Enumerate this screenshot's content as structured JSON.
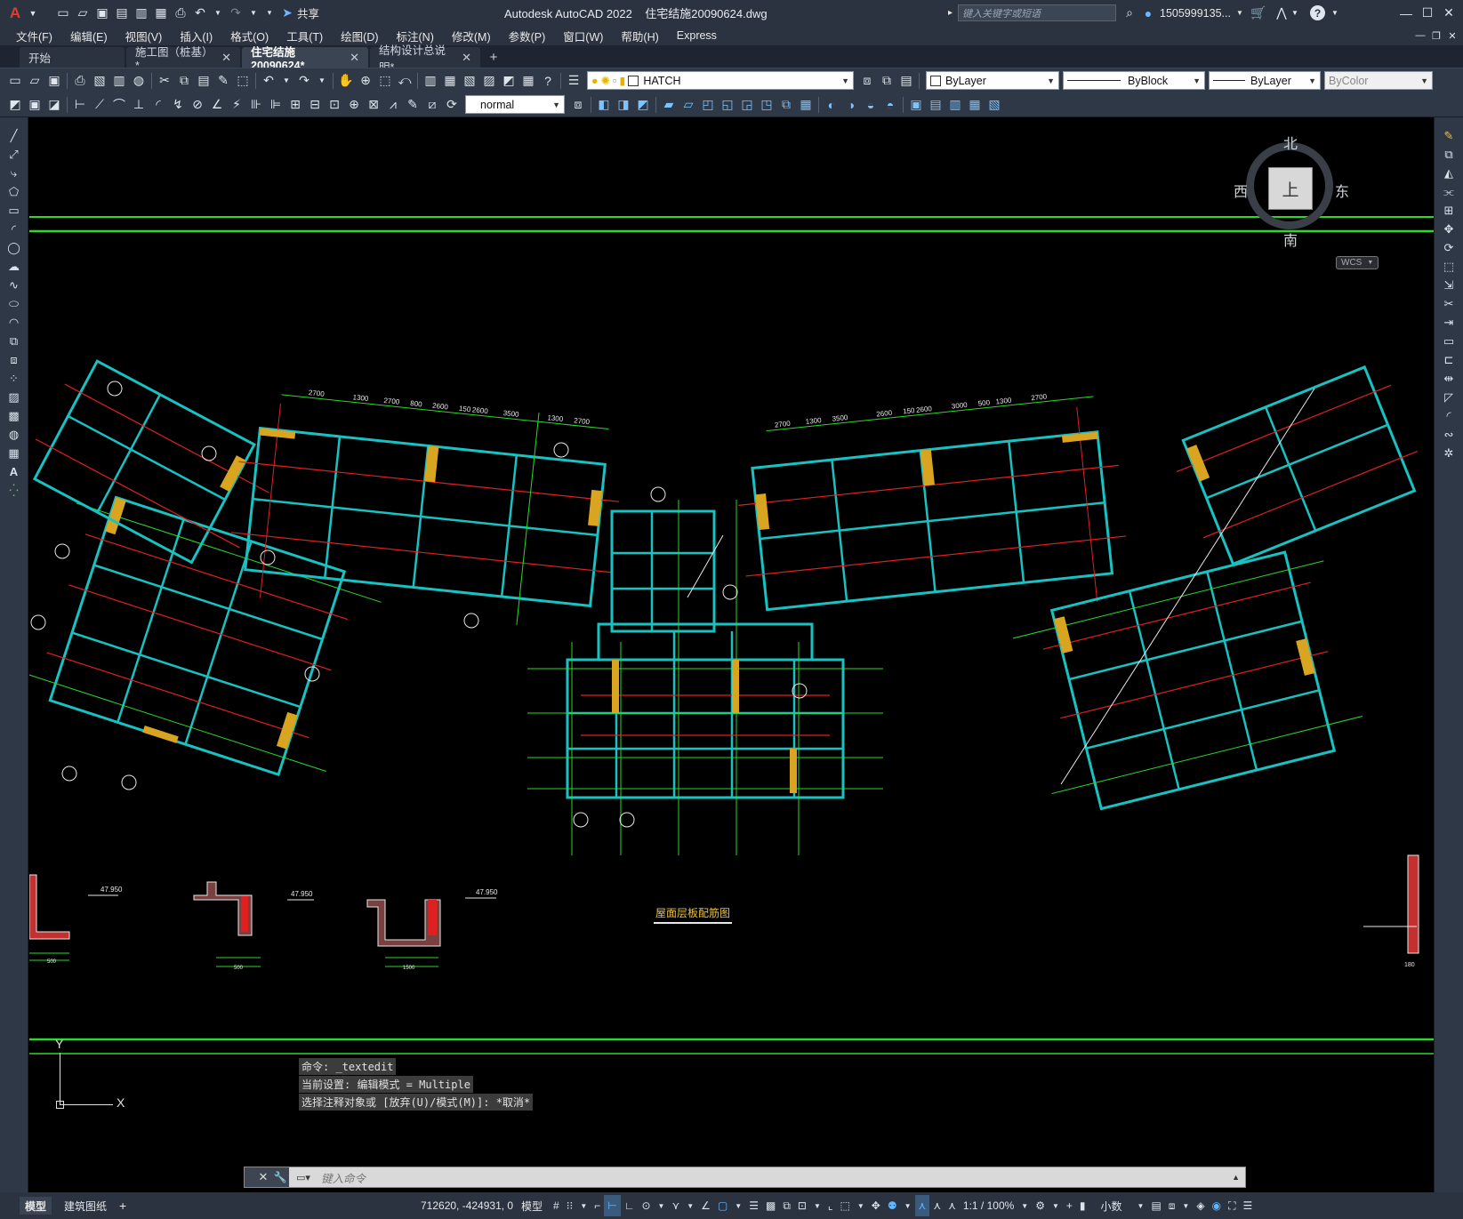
{
  "app": {
    "logo": "A",
    "share_label": "共享",
    "title": "Autodesk AutoCAD 2022    住宅结施20090624.dwg",
    "search_placeholder": "键入关键字或短语",
    "user": "1505999135...",
    "help": "?"
  },
  "menu": [
    "文件(F)",
    "编辑(E)",
    "视图(V)",
    "插入(I)",
    "格式(O)",
    "工具(T)",
    "绘图(D)",
    "标注(N)",
    "修改(M)",
    "参数(P)",
    "窗口(W)",
    "帮助(H)",
    "Express"
  ],
  "tabs": [
    {
      "label": "开始",
      "close": "",
      "active": false
    },
    {
      "label": "施工图（桩基）*",
      "close": "✕",
      "active": false
    },
    {
      "label": "住宅结施20090624*",
      "close": "✕",
      "active": true
    },
    {
      "label": "结构设计总说明*",
      "close": "✕",
      "active": false
    }
  ],
  "tab_add": "+",
  "toolbar": {
    "layer": "HATCH",
    "color": "ByLayer",
    "linetype": "ByBlock",
    "lineweight": "ByLayer",
    "plotstyle": "ByColor",
    "dimstyle": "normal"
  },
  "viewcube": {
    "north": "北",
    "south": "南",
    "east": "东",
    "west": "西",
    "top": "上",
    "wcs": "WCS"
  },
  "drawing": {
    "plan_title": "屋面层板配筋图",
    "elevation_1": "47.950",
    "elevation_2": "47.950",
    "elevation_3": "47.950",
    "dims_top_left": [
      "2700",
      "1300",
      "2700",
      "800",
      "2600",
      "150",
      "2600",
      "3500",
      "1300",
      "2700"
    ],
    "dims_top_right": [
      "2700",
      "1300",
      "3500",
      "2600",
      "150",
      "2600",
      "3000",
      "500",
      "1300",
      "2700"
    ],
    "section_dim_a": "500",
    "section_dim_b": "500",
    "section_dim_c": "1500",
    "section_dim_d": "180"
  },
  "command": {
    "history": [
      "命令: _textedit",
      "当前设置: 编辑模式 = Multiple",
      "选择注释对象或 [放弃(U)/模式(M)]: *取消*"
    ],
    "placeholder": "键入命令"
  },
  "ucs": {
    "y": "Y",
    "x": "X"
  },
  "status": {
    "layout_tabs": [
      "模型",
      "建筑图纸"
    ],
    "layout_add": "+",
    "coords": "712620, -424931, 0",
    "space": "模型",
    "scale": "1:1 / 100%",
    "units": "小数"
  }
}
